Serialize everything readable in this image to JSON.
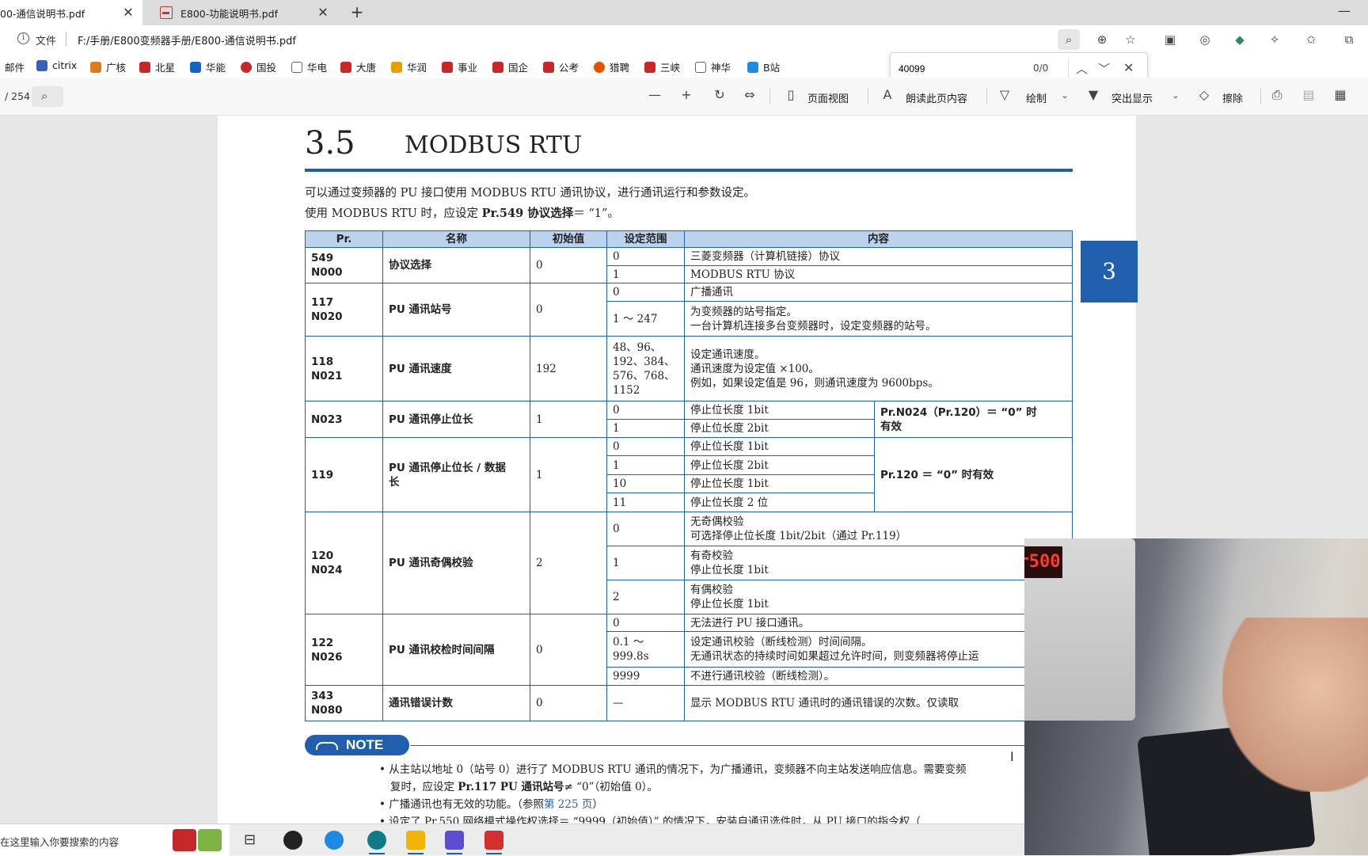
{
  "tabs": [
    {
      "label": "00-通信说明书.pdf",
      "active": true
    },
    {
      "label": "E800-功能说明书.pdf",
      "active": false
    }
  ],
  "address": {
    "file_label": "文件",
    "url": "F:/手册/E800变频器手册/E800-通信说明书.pdf"
  },
  "favorites": [
    {
      "label": "邮件",
      "color": ""
    },
    {
      "label": "citrix",
      "color": "#3a5fb8"
    },
    {
      "label": "广核",
      "color": "#e07b1a"
    },
    {
      "label": "北星",
      "color": "#c62828"
    },
    {
      "label": "华能",
      "color": "#1565c0"
    },
    {
      "label": "国投",
      "color": "#c62828"
    },
    {
      "label": "华电",
      "color": "#666666"
    },
    {
      "label": "大唐",
      "color": "#c62828"
    },
    {
      "label": "华润",
      "color": "#e5a000"
    },
    {
      "label": "事业",
      "color": "#c62828"
    },
    {
      "label": "国企",
      "color": "#c62828"
    },
    {
      "label": "公考",
      "color": "#c62828"
    },
    {
      "label": "猎聘",
      "color": "#e65100"
    },
    {
      "label": "三峡",
      "color": "#c62828"
    },
    {
      "label": "神华",
      "color": "#666666"
    },
    {
      "label": "B站",
      "color": "#1e88e5"
    }
  ],
  "find": {
    "query": "40099",
    "count": "0/0"
  },
  "pdf_toolbar": {
    "page_total": "/ 254",
    "page_view": "页面视图",
    "read_aloud": "朗读此页内容",
    "draw": "绘制",
    "highlight": "突出显示",
    "erase": "擦除"
  },
  "doc": {
    "section_number": "3.5",
    "section_title": "MODBUS RTU",
    "chapter_tab": "3",
    "intro1": "可以通过变频器的 PU 接口使用 MODBUS RTU 通讯协议，进行通讯运行和参数设定。",
    "intro2_pre": "使用 MODBUS RTU 时，应设定 ",
    "intro2_bold": "Pr.549 协议选择",
    "intro2_post": "＝ “1”。",
    "table_headers": {
      "pr": "Pr.",
      "name": "名称",
      "init": "初始值",
      "range": "设定范围",
      "content": "内容"
    },
    "rows": [
      {
        "pr": "549\nN000",
        "name": "协议选择",
        "init": "0",
        "subs": [
          {
            "range": "0",
            "content": "三菱变频器（计算机链接）协议"
          },
          {
            "range": "1",
            "content": "MODBUS RTU 协议"
          }
        ]
      },
      {
        "pr": "117\nN020",
        "name": "PU 通讯站号",
        "init": "0",
        "subs": [
          {
            "range": "0",
            "content": "广播通讯"
          },
          {
            "range": "1 ～ 247",
            "content": "为变频器的站号指定。\n一台计算机连接多台变频器时，设定变频器的站号。"
          }
        ]
      },
      {
        "pr": "118\nN021",
        "name": "PU 通讯速度",
        "init": "192",
        "subs": [
          {
            "range": "48、96、\n192、384、\n576、768、\n1152",
            "content": "设定通讯速度。\n通讯速度为设定值 ×100。\n例如，如果设定值是 96，则通讯速度为 9600bps。"
          }
        ]
      },
      {
        "pr": "N023",
        "name": "PU 通讯停止位长",
        "init": "1",
        "subs": [
          {
            "range": "0",
            "content": "停止位长度 1bit"
          },
          {
            "range": "1",
            "content": "停止位长度 2bit"
          }
        ],
        "note": "Pr.N024（Pr.120）＝ “0” 时\n有效"
      },
      {
        "pr": "119",
        "name": "PU 通讯停止位长 / 数据\n长",
        "init": "1",
        "subs": [
          {
            "range": "0",
            "content": "停止位长度 1bit"
          },
          {
            "range": "1",
            "content": "停止位长度 2bit"
          },
          {
            "range": "10",
            "content": "停止位长度 1bit"
          },
          {
            "range": "11",
            "content": "停止位长度 2 位"
          }
        ],
        "note": "Pr.120 ＝ “0” 时有效"
      },
      {
        "pr": "120\nN024",
        "name": "PU 通讯奇偶校验",
        "init": "2",
        "subs": [
          {
            "range": "0",
            "content": "无奇偶校验\n可选择停止位长度 1bit/2bit（通过 Pr.119）"
          },
          {
            "range": "1",
            "content": "有奇校验\n停止位长度 1bit"
          },
          {
            "range": "2",
            "content": "有偶校验\n停止位长度 1bit"
          }
        ]
      },
      {
        "pr": "122\nN026",
        "name": "PU 通讯校检时间间隔",
        "init": "0",
        "subs": [
          {
            "range": "0",
            "content": "无法进行 PU 接口通讯。"
          },
          {
            "range": "0.1 ～\n999.8s",
            "content": "设定通讯校验（断线检测）时间间隔。\n无通讯状态的持续时间如果超过允许时间，则变频器将停止运"
          },
          {
            "range": "9999",
            "content": "不进行通讯校验（断线检测）。"
          }
        ]
      },
      {
        "pr": "343\nN080",
        "name": "通讯错误计数",
        "init": "0",
        "subs": [
          {
            "range": "—",
            "content": "显示 MODBUS RTU 通讯时的通讯错误的次数。仅读取"
          }
        ]
      }
    ],
    "note_label": "NOTE",
    "note_lines": {
      "l1": "• 从主站以地址 0（站号 0）进行了 MODBUS RTU 通讯的情况下，为广播通讯，变频器不向主站发送响应信息。需要变频",
      "l2_pre": "复时，应设定 ",
      "l2_bold": "Pr.117 PU 通讯站号",
      "l2_post": "≠ “0”（初始值 0）。",
      "l3_pre": "• 广播通讯也有无效的功能。（参照",
      "l3_link": "第 225 页",
      "l3_post": "）",
      "l4": "• 设定了 Pr.550 网络模式操作权选择＝ “9999（初始值）” 的情况下，安装自通讯选件时，从 PU 接口的指令权（"
    }
  },
  "webcam": {
    "display": "r500"
  },
  "taskbar": {
    "search_placeholder": "在这里输入你要搜索的内容"
  }
}
